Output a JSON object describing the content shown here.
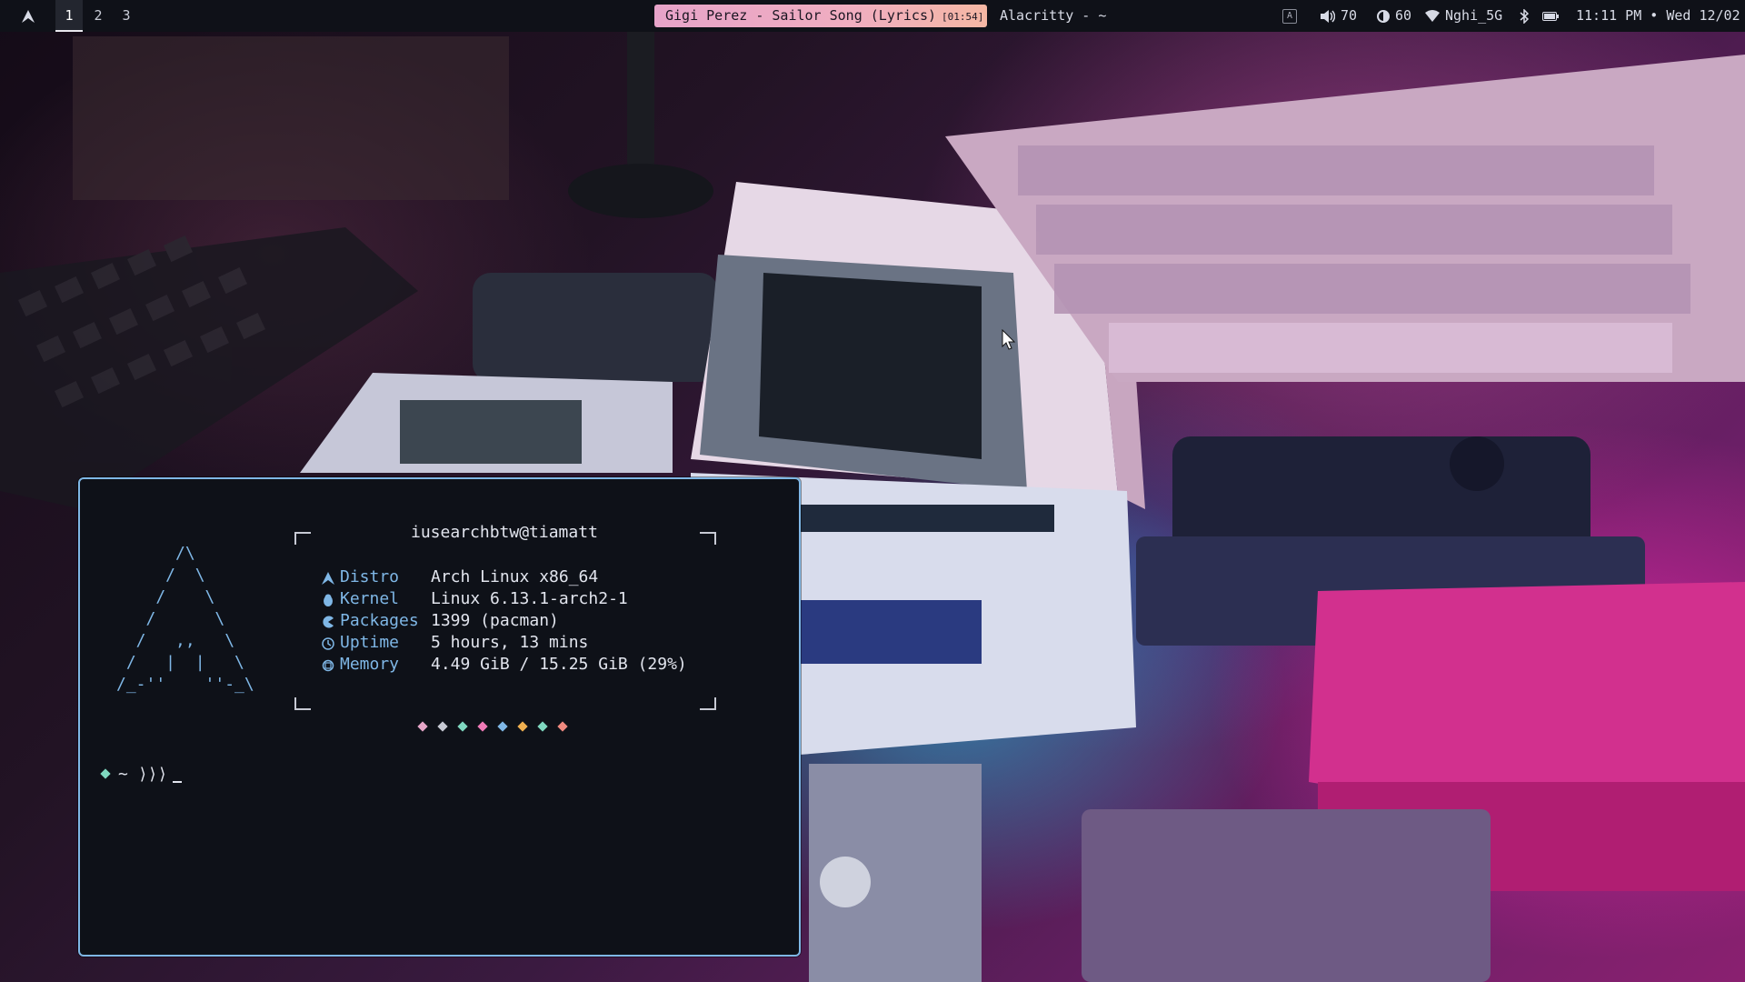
{
  "topbar": {
    "workspaces": [
      "1",
      "2",
      "3"
    ],
    "active_workspace": "1",
    "media": {
      "title": "Gigi Perez - Sailor Song (Lyrics)",
      "time": "[01:54]"
    },
    "window_title": "Alacritty - ~",
    "keyboard_indicator": "A",
    "volume": "70",
    "brightness": "60",
    "wifi": "Nghi_5G",
    "clock": "11:11 PM • Wed 12/02",
    "icons": {
      "launcher": "arch-logo-icon",
      "volume": "speaker-icon",
      "brightness": "brightness-icon",
      "wifi": "wifi-icon",
      "bluetooth": "bluetooth-icon",
      "battery": "battery-icon"
    }
  },
  "terminal": {
    "ascii_art": "      /\\\n     /  \\\n    /    \\\n   /      \\\n  /   ,,   \\\n /   |  |   \\\n/_-''    ''-_\\",
    "userhost": "iusearchbtw@tiamatt",
    "info": [
      {
        "key": "distro",
        "label": "Distro",
        "value": "Arch Linux x86_64",
        "icon": "arch-logo-icon"
      },
      {
        "key": "kernel",
        "label": "Kernel",
        "value": "Linux 6.13.1-arch2-1",
        "icon": "tux-icon"
      },
      {
        "key": "packages",
        "label": "Packages",
        "value": "1399 (pacman)",
        "icon": "pacman-icon"
      },
      {
        "key": "uptime",
        "label": "Uptime",
        "value": "5 hours, 13 mins",
        "icon": "clock-icon"
      },
      {
        "key": "memory",
        "label": "Memory",
        "value": "4.49 GiB / 15.25 GiB (29%)",
        "icon": "memory-icon"
      }
    ],
    "swatch_colors": [
      "#e6a6c8",
      "#c7cad4",
      "#7fd8c0",
      "#f07ab7",
      "#7fb7e6",
      "#f0b050",
      "#7fd8c0",
      "#f08a80"
    ],
    "prompt": {
      "path": "~",
      "arrows": "⟩⟩⟩"
    }
  },
  "colors": {
    "accent": "#7fb7e6",
    "terminal_bg": "#0e1118",
    "topbar_bg": "#0f1118",
    "media_pill": "#f0aec0"
  }
}
